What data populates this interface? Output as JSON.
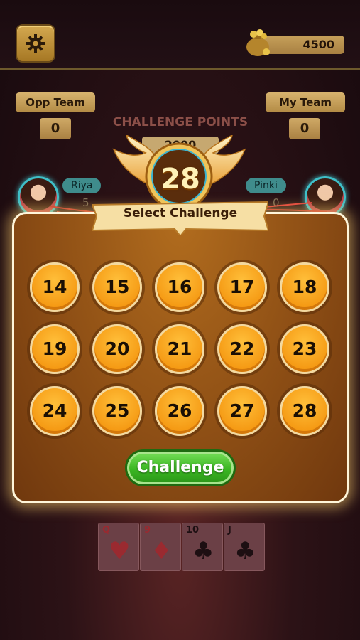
{
  "header": {
    "coins": "4500"
  },
  "teams": {
    "opp": {
      "label": "Opp Team",
      "score": "0"
    },
    "my": {
      "label": "My Team",
      "score": "0"
    }
  },
  "challenge_points": {
    "title": "CHALLENGE POINTS",
    "value": "2000"
  },
  "players": {
    "left": {
      "name": "Riya",
      "score": "5"
    },
    "right": {
      "name": "Pinki",
      "score": "0"
    }
  },
  "modal": {
    "emblem_value": "28",
    "title": "Select Challenge",
    "options": [
      "14",
      "15",
      "16",
      "17",
      "18",
      "19",
      "20",
      "21",
      "22",
      "23",
      "24",
      "25",
      "26",
      "27",
      "28"
    ],
    "action_label": "Challenge"
  },
  "hand": [
    {
      "rank": "Q",
      "suit": "♥",
      "color": "red"
    },
    {
      "rank": "9",
      "suit": "♦",
      "color": "red"
    },
    {
      "rank": "10",
      "suit": "♣",
      "color": "black"
    },
    {
      "rank": "J",
      "suit": "♣",
      "color": "black"
    }
  ],
  "colors": {
    "accent_gold": "#d4a850",
    "challenge_green": "#3ab622",
    "option_orange": "#f59a14"
  },
  "icons": {
    "settings": "gear-icon",
    "coins": "coin-bag-icon"
  }
}
